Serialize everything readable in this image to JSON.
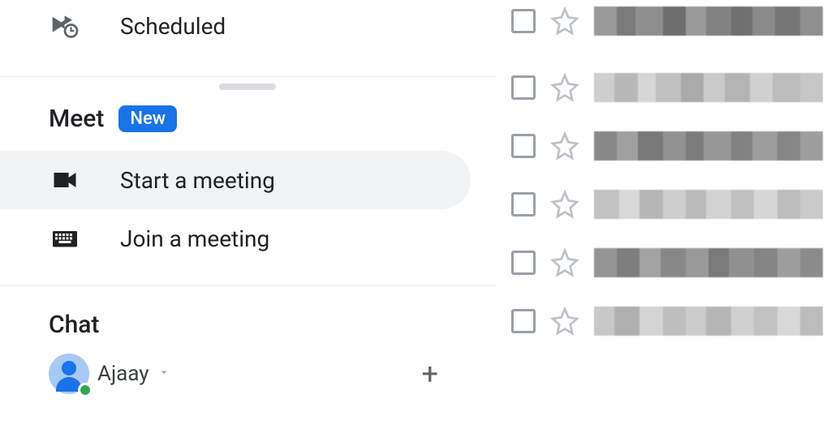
{
  "sidebar": {
    "scheduled_label": "Scheduled",
    "meet": {
      "title": "Meet",
      "badge": "New",
      "start_label": "Start a meeting",
      "join_label": "Join a meeting"
    },
    "chat": {
      "title": "Chat",
      "user_name": "Ajaay"
    }
  }
}
